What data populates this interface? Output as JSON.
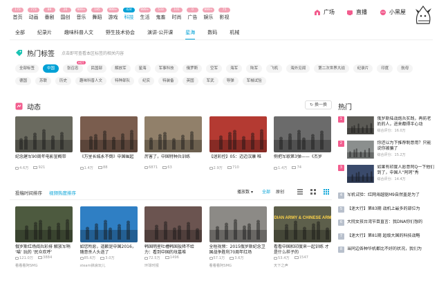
{
  "nav": [
    {
      "count": "173",
      "label": "首页",
      "active": false
    },
    {
      "count": "773",
      "label": "动画",
      "active": false
    },
    {
      "count": "88",
      "label": "番剧",
      "active": false
    },
    {
      "count": "26",
      "label": "国创",
      "active": false
    },
    {
      "count": "999+",
      "label": "音乐",
      "active": false
    },
    {
      "count": "185",
      "label": "舞蹈",
      "active": false
    },
    {
      "count": "999+",
      "label": "游戏",
      "active": false
    },
    {
      "count": "424",
      "label": "科技",
      "active": true
    },
    {
      "count": "999+",
      "label": "生活",
      "active": false
    },
    {
      "count": "533",
      "label": "鬼畜",
      "active": false
    },
    {
      "count": "101",
      "label": "时尚",
      "active": false
    },
    {
      "count": "0",
      "label": "广告",
      "active": false
    },
    {
      "count": "999+",
      "label": "娱乐",
      "active": false
    },
    {
      "count": "75",
      "label": "影视",
      "active": false
    }
  ],
  "nav_right": {
    "plaza": "广场",
    "live": "直播",
    "blackroom": "小黑屋"
  },
  "subnav": [
    {
      "label": "全部",
      "active": false
    },
    {
      "label": "纪录片",
      "active": false
    },
    {
      "label": "趣味科普人文",
      "active": false
    },
    {
      "label": "野生技术协会",
      "active": false
    },
    {
      "label": "演讲·公开课",
      "active": false
    },
    {
      "label": "星海",
      "active": true
    },
    {
      "label": "数码",
      "active": false
    },
    {
      "label": "机械",
      "active": false
    }
  ],
  "hot_tags": {
    "title": "热门标签",
    "tip": "点击即可查看本区标签的相关内容",
    "row1": [
      {
        "label": "全部标签",
        "active": false
      },
      {
        "label": "中国",
        "active": true
      },
      {
        "label": "张召忠",
        "active": false,
        "badge": "HOT"
      },
      {
        "label": "民国部",
        "active": false
      },
      {
        "label": "解放军",
        "active": false
      },
      {
        "label": "星海",
        "active": false
      },
      {
        "label": "军事科技",
        "active": false
      },
      {
        "label": "俄罗斯",
        "active": false
      },
      {
        "label": "空军",
        "active": false
      },
      {
        "label": "海军",
        "active": false
      },
      {
        "label": "陆军",
        "active": false
      },
      {
        "label": "飞机",
        "active": false
      },
      {
        "label": "海外见闻",
        "active": false
      },
      {
        "label": "第二次世界大战",
        "active": false
      },
      {
        "label": "纪录片",
        "active": false
      },
      {
        "label": "印度",
        "active": false
      },
      {
        "label": "航母",
        "active": false
      }
    ],
    "row2": [
      {
        "label": "德国",
        "active": false
      },
      {
        "label": "苏联",
        "active": false
      },
      {
        "label": "历史",
        "active": false
      },
      {
        "label": "趣味科普人文",
        "active": false
      },
      {
        "label": "特种部队",
        "active": false
      },
      {
        "label": "纪实",
        "active": false
      },
      {
        "label": "特装备",
        "active": false
      },
      {
        "label": "英国",
        "active": false
      },
      {
        "label": "军武",
        "active": false
      },
      {
        "label": "导弹",
        "active": false
      },
      {
        "label": "军械试验",
        "active": false
      }
    ]
  },
  "dynamic": {
    "title": "动态",
    "refresh": "换一换",
    "cards": [
      {
        "title": "纪念建军90周年电影宣概带",
        "plays": "4.6万",
        "danmu": "921",
        "color": "#6a6a5f"
      },
      {
        "title": "《万里长城永不倒》中国崛起",
        "plays": "1.4万",
        "danmu": "88",
        "color": "#7a5d4e"
      },
      {
        "title": "厉害了，中国特种兵训练",
        "plays": "6871",
        "danmu": "63",
        "color": "#91806a"
      },
      {
        "title": "【迷彩控】05：迈迈汉康 唯",
        "plays": "2.9万",
        "danmu": "710",
        "color": "#b43a32"
      },
      {
        "title": "侧把军歌第3弹——《杰罗",
        "plays": "1.4万",
        "danmu": "74",
        "color": "#6b6b6b"
      }
    ]
  },
  "sort": {
    "tabs": [
      {
        "label": "投稿时间排序",
        "active": false
      },
      {
        "label": "视频热度排序",
        "active": true
      }
    ],
    "filter": "播放数",
    "segments": [
      {
        "label": "全部",
        "active": true
      },
      {
        "label": "原创",
        "active": false
      }
    ]
  },
  "grid_cards": [
    {
      "title": "俄罗斯红场阅兵彩排 解放军哨 ‘喵’ 玩的 ‘民众欢呼’",
      "plays": "121.0万",
      "danmu": "3884",
      "up": "看看看阿SMG",
      "color": "#4d5a3f"
    },
    {
      "title": "如您所愿，道歉是中国2016，随意杀人头逝了",
      "plays": "85.6万",
      "danmu": "3.0万",
      "up": "steam搞哀玩儿",
      "color": "#2f7fc4"
    },
    {
      "title": "韩国明星吐槽韩国投降不给力：看到中国的坟墓堆",
      "plays": "72.5万",
      "danmu": "1496",
      "up": "环球时报",
      "color": "#6b5450"
    },
    {
      "title": "全程视频：2015俄罗斯纪念卫国战争胜利70周年红场",
      "plays": "57.1万",
      "danmu": "3.6万",
      "up": "看看看阿SMG",
      "color": "#8c8a86"
    },
    {
      "title": "看看中国和印度来一起训练 才是什么样子的",
      "plays": "53.4万",
      "danmu": "1547",
      "up": "天下之声",
      "color": "#5d5f4b",
      "overlay": "INDIAN ARMY & CHINESE ARMY"
    }
  ],
  "ranking": {
    "title": "热门",
    "top": [
      {
        "num": "1",
        "title": "俄罗斯陆战炮兵实践，再防老奶的人，进来都得半心动",
        "plays": "综合评分：16.0万",
        "color": "#5b5a55"
      },
      {
        "num": "2",
        "title": "你还以为下推荐制意用？只能说你被骗了",
        "plays": "综合评分：15.2万",
        "color": "#8b8f8e"
      },
      {
        "num": "3",
        "title": "如果有印度人愿意阿Q一下他们到了，中国人“阿珂”秀",
        "plays": "综合评分：14.4万",
        "color": "#3a4a6b"
      }
    ],
    "list": [
      {
        "num": "4",
        "title": "军机试验：红网海越驱M9自然盖是为了"
      },
      {
        "num": "5",
        "title": "【迷大行】第83期 战机上最多的部位为"
      },
      {
        "num": "6",
        "title": "大院女孩台湾节目直言：我DNA你们想的"
      },
      {
        "num": "7",
        "title": "【迷大行】第81期 超级大国的科技战略"
      },
      {
        "num": "8",
        "title": "当同边各种华机都比不好的状况，我们为"
      }
    ]
  }
}
